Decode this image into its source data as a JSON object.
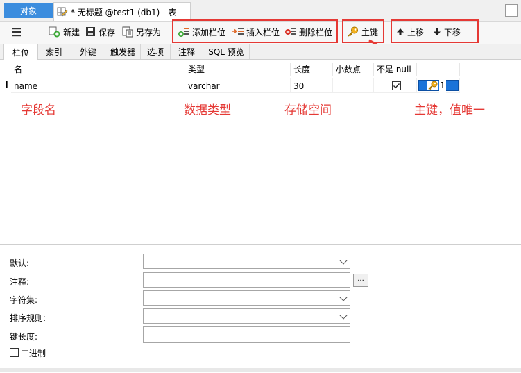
{
  "tabs": {
    "objects": "对象",
    "document": "* 无标题 @test1 (db1) - 表"
  },
  "toolbar": {
    "new": "新建",
    "save": "保存",
    "save_as": "另存为",
    "add_field": "添加栏位",
    "insert_field": "插入栏位",
    "delete_field": "删除栏位",
    "primary_key": "主键",
    "move_up": "上移",
    "move_down": "下移"
  },
  "subtabs": [
    "栏位",
    "索引",
    "外键",
    "触发器",
    "选项",
    "注释",
    "SQL 预览"
  ],
  "grid": {
    "columns": [
      "名",
      "类型",
      "长度",
      "小数点",
      "不是 null",
      ""
    ],
    "rows": [
      {
        "name": "name",
        "type": "varchar",
        "length": "30",
        "decimals": "",
        "not_null": true,
        "key": "1"
      }
    ]
  },
  "annotations": {
    "field_name": "字段名",
    "data_type": "数据类型",
    "storage": "存储空间",
    "primary_key": "主键，值唯一"
  },
  "properties": {
    "default_label": "默认:",
    "comment_label": "注释:",
    "charset_label": "字符集:",
    "collation_label": "排序规则:",
    "key_length_label": "键长度:",
    "binary_label": "二进制",
    "ellipsis": "..."
  },
  "colors": {
    "accent": "#3c8dde",
    "annotation": "#e53935"
  }
}
